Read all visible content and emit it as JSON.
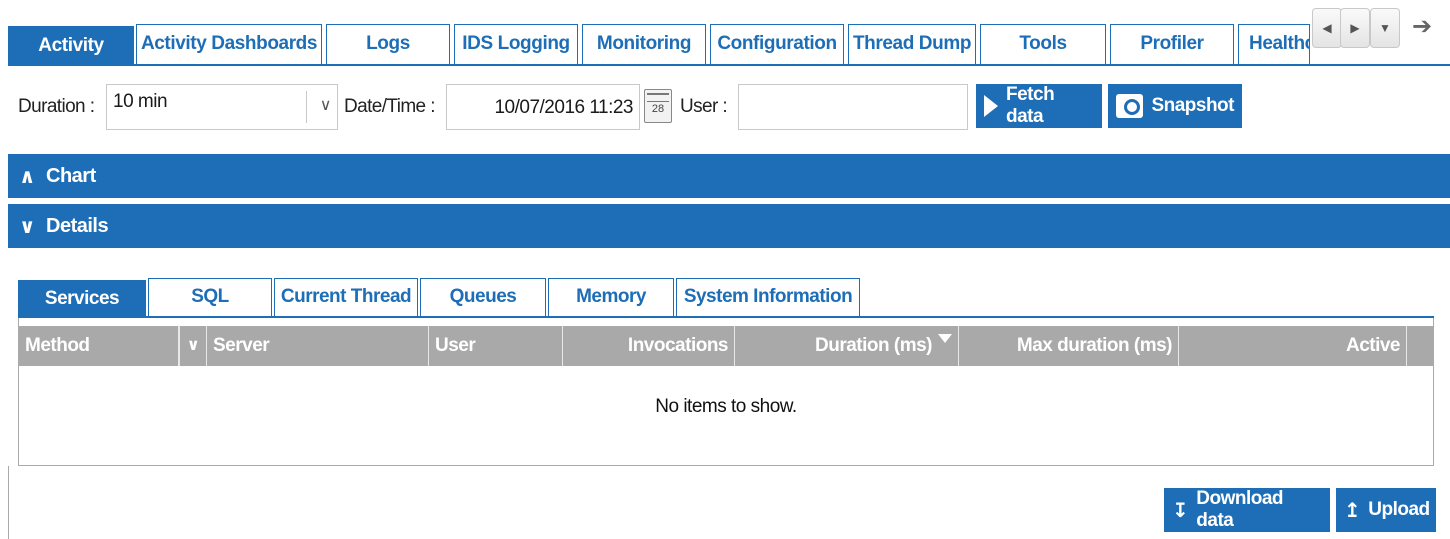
{
  "top_tabs": [
    {
      "label": "Activity",
      "active": true
    },
    {
      "label": "Activity Dashboards"
    },
    {
      "label": "Logs"
    },
    {
      "label": "IDS Logging"
    },
    {
      "label": "Monitoring"
    },
    {
      "label": "Configuration"
    },
    {
      "label": "Thread Dump"
    },
    {
      "label": "Tools"
    },
    {
      "label": "Profiler"
    },
    {
      "label": "Healthc"
    }
  ],
  "nav": {
    "prev_icon": "caret-left-icon",
    "next_icon": "caret-right-icon",
    "menu_icon": "caret-down-icon",
    "logout_icon": "logout-icon"
  },
  "filter": {
    "duration_label": "Duration :",
    "duration_value": "10 min",
    "datetime_label": "Date/Time :",
    "datetime_value": "10/07/2016 11:23",
    "calendar_day": "28",
    "user_label": "User :",
    "user_value": "",
    "fetch_label": "Fetch data",
    "snapshot_label": "Snapshot"
  },
  "sections": {
    "chart_label": "Chart",
    "details_label": "Details"
  },
  "sub_tabs": [
    {
      "label": "Services",
      "active": true
    },
    {
      "label": "SQL"
    },
    {
      "label": "Current Thread"
    },
    {
      "label": "Queues"
    },
    {
      "label": "Memory"
    },
    {
      "label": "System Information"
    }
  ],
  "grid": {
    "columns": [
      "Method",
      "Server",
      "User",
      "Invocations",
      "Duration (ms)",
      "Max duration (ms)",
      "Active"
    ],
    "sorted_column": "Duration (ms)",
    "empty_message": "No items to show."
  },
  "footer": {
    "download_label": "Download data",
    "upload_label": "Upload"
  },
  "colors": {
    "accent": "#1e6eb7",
    "grid_header": "#a9a9a9"
  }
}
